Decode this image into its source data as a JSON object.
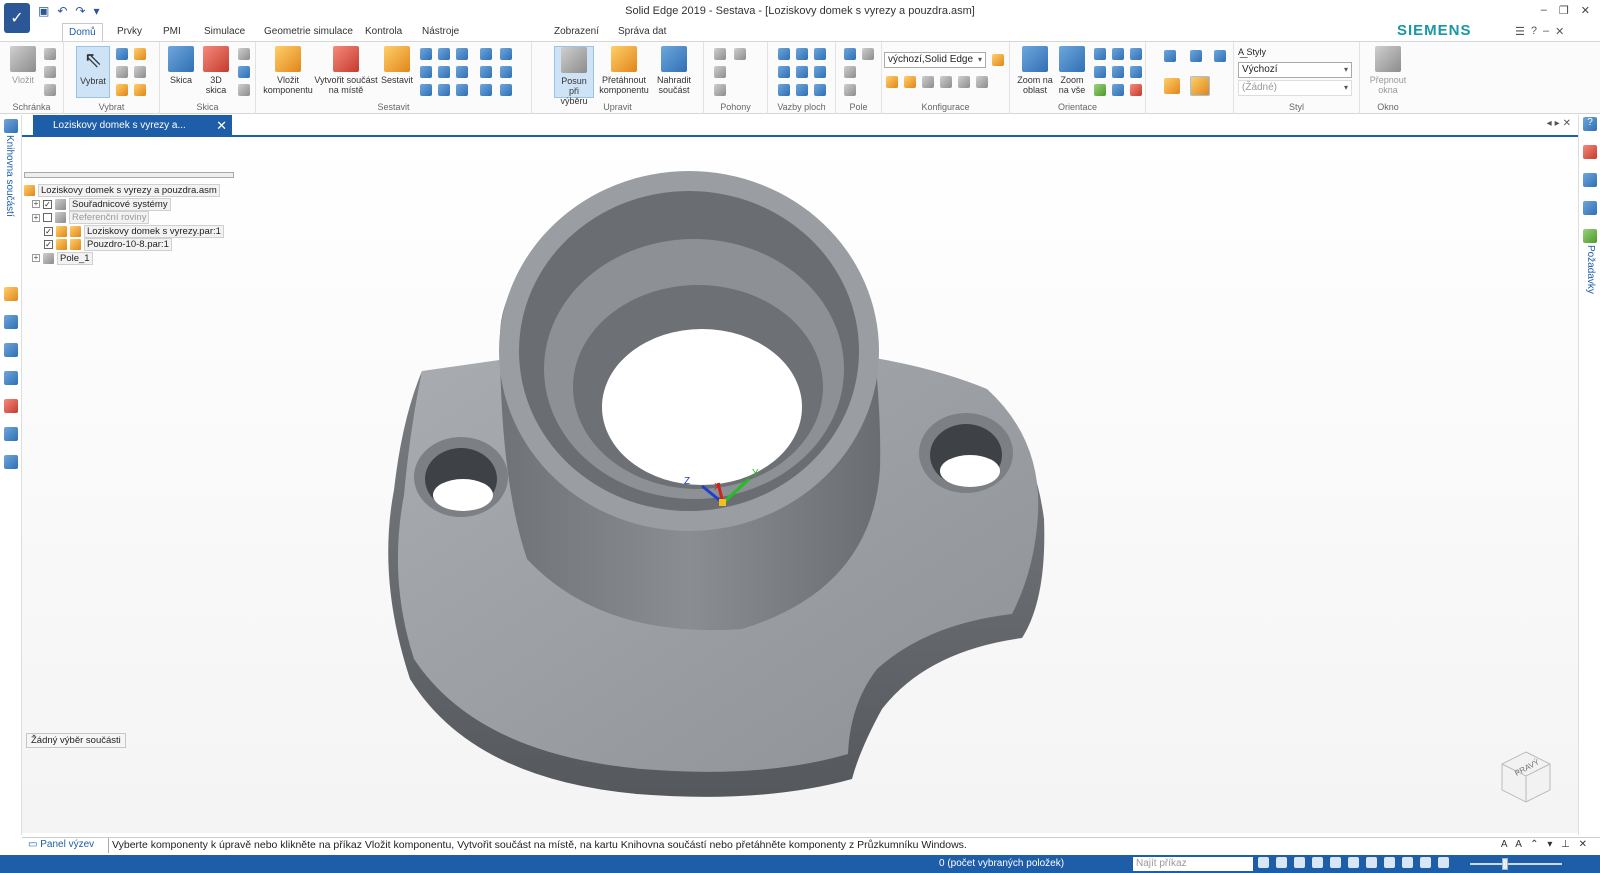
{
  "window": {
    "title": "Solid Edge 2019 - Sestava - [Loziskovy domek s vyrezy a pouzdra.asm]",
    "brand": "SIEMENS"
  },
  "tabs": [
    "Domů",
    "Prvky",
    "PMI",
    "Simulace",
    "Geometrie simulace",
    "Kontrola",
    "Nástroje",
    "Zobrazení",
    "Správa dat"
  ],
  "ribbon": {
    "groups": {
      "schranka": "Schránka",
      "vybrat": "Vybrat",
      "skica": "Skica",
      "sestavit": "Sestavit",
      "upravit": "Upravit",
      "pohony": "Pohony",
      "vazby_ploch": "Vazby ploch",
      "pole": "Pole",
      "konfigurace": "Konfigurace",
      "orientace": "Orientace",
      "styl": "Styl",
      "okno": "Okno"
    },
    "buttons": {
      "vlozit": "Vložit",
      "vybrat": "Vybrat",
      "skica": "Skica",
      "skica3d_1": "3D",
      "skica3d_2": "skica",
      "vlozit_komp_1": "Vložit",
      "vlozit_komp_2": "komponentu",
      "vytvorit_1": "Vytvořit součást",
      "vytvorit_2": "na místě",
      "sestavit": "Sestavit",
      "posun_1": "Posun při",
      "posun_2": "výběru",
      "pretahnout_1": "Přetáhnout",
      "pretahnout_2": "komponentu",
      "nahradit_1": "Nahradit",
      "nahradit_2": "součást",
      "zoom_oblast_1": "Zoom na",
      "zoom_oblast_2": "oblast",
      "zoom_vse_1": "Zoom",
      "zoom_vse_2": "na vše",
      "styly": "Styly",
      "prepnout_1": "Přepnout",
      "prepnout_2": "okna"
    },
    "config_combo": "výchozí,Solid Edge",
    "style_combo": "Výchozí",
    "style_combo2": "(Žádné)"
  },
  "document_tab": "Loziskovy domek s vyrezy a...",
  "left_panel_label": "Knihovna součástí",
  "right_panel_label": "Požadavky",
  "tree": {
    "root": "Loziskovy domek s vyrezy a pouzdra.asm",
    "items": [
      {
        "label": "Souřadnicové systémy",
        "checked": true
      },
      {
        "label": "Referenční roviny",
        "checked": false
      },
      {
        "label": "Loziskovy domek s vyrezy.par:1",
        "checked": true
      },
      {
        "label": "Pouzdro-10-8.par:1",
        "checked": true
      },
      {
        "label": "Pole_1",
        "checked": null
      }
    ]
  },
  "no_selection": "Žádný výběr součásti",
  "orientation_cube_label": "PRAVÝ",
  "axis_labels": {
    "z": "Z",
    "x": "X",
    "y": "Y"
  },
  "prompt": {
    "panel_button": "Panel výzev",
    "text": "Vyberte komponenty k úpravě nebo klikněte na příkaz Vložit komponentu, Vytvořit součást na místě, na kartu Knihovna součástí nebo přetáhněte komponenty z Průzkumníku Windows."
  },
  "status": {
    "selected_count": "0 (počet vybraných položek)",
    "command_search_placeholder": "Najít příkaz"
  }
}
